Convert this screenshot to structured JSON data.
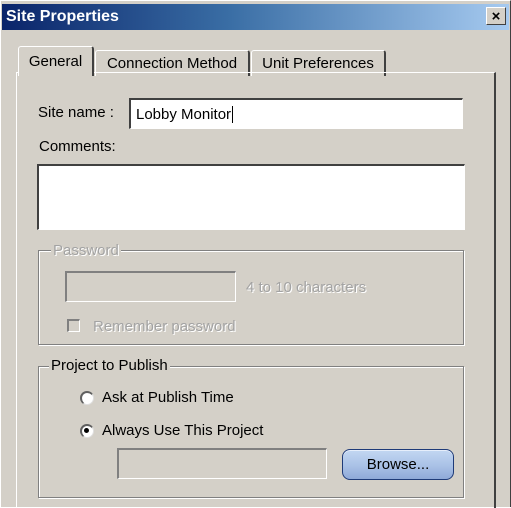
{
  "window": {
    "title": "Site Properties",
    "close_glyph": "×"
  },
  "tabs": [
    {
      "label": "General",
      "active": true
    },
    {
      "label": "Connection Method",
      "active": false
    },
    {
      "label": "Unit Preferences",
      "active": false
    }
  ],
  "general": {
    "site_name_label": "Site name :",
    "site_name_value": "Lobby Monitor",
    "comments_label": "Comments:",
    "comments_value": ""
  },
  "password": {
    "legend": "Password",
    "value": "",
    "hint": "4 to 10 characters",
    "remember_label": "Remember password",
    "remember_checked": false,
    "enabled": false
  },
  "project": {
    "legend": "Project to Publish",
    "option_ask_label": "Ask at Publish Time",
    "option_always_label": "Always Use This Project",
    "selected": "always",
    "path_value": "",
    "browse_label": "Browse..."
  },
  "colors": {
    "face": "#d4d0c8",
    "title_start": "#0a246a",
    "title_end": "#a6caf0",
    "disabled_text": "#a3a3a3",
    "browse_button": "#a9c1e6"
  },
  "icons": {
    "close": "close-icon",
    "radio": "radio-icon",
    "checkbox": "checkbox-icon"
  }
}
